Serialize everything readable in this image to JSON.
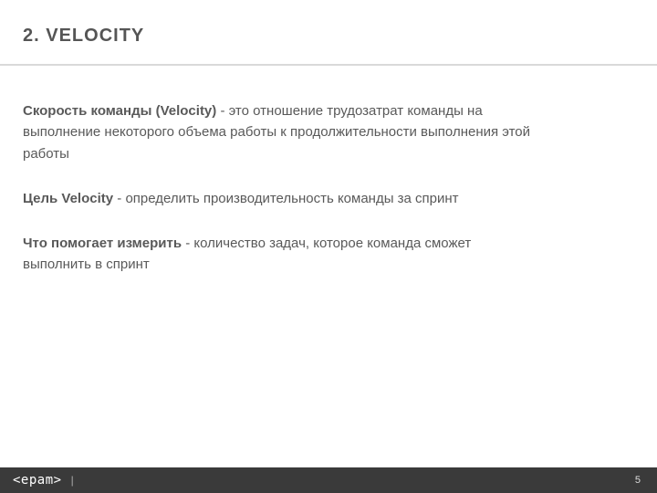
{
  "title": "2. VELOCITY",
  "paragraphs": [
    {
      "bold": "Скорость команды (Velocity)",
      "rest": " - это отношение трудозатрат команды на выполнение некоторого объема работы к продолжительности выполнения этой работы"
    },
    {
      "bold": "Цель Velocity",
      "rest": " - определить производительность команды за спринт"
    },
    {
      "bold": "Что помогает измерить",
      "rest": " - количество задач, которое команда сможет выполнить в спринт"
    }
  ],
  "footer": {
    "logo": "<epam>",
    "divider": "|",
    "page": "5"
  }
}
